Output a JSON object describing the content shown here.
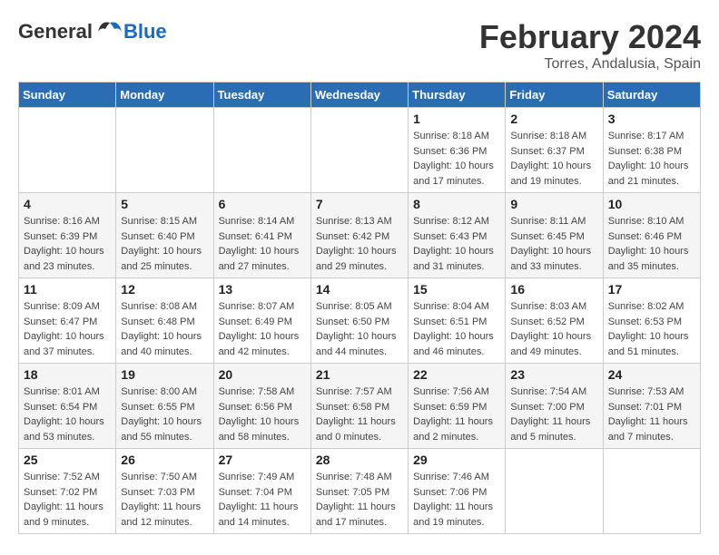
{
  "header": {
    "logo_general": "General",
    "logo_blue": "Blue",
    "month_year": "February 2024",
    "location": "Torres, Andalusia, Spain"
  },
  "days_of_week": [
    "Sunday",
    "Monday",
    "Tuesday",
    "Wednesday",
    "Thursday",
    "Friday",
    "Saturday"
  ],
  "weeks": [
    [
      {
        "day": "",
        "info": ""
      },
      {
        "day": "",
        "info": ""
      },
      {
        "day": "",
        "info": ""
      },
      {
        "day": "",
        "info": ""
      },
      {
        "day": "1",
        "info": "Sunrise: 8:18 AM\nSunset: 6:36 PM\nDaylight: 10 hours\nand 17 minutes."
      },
      {
        "day": "2",
        "info": "Sunrise: 8:18 AM\nSunset: 6:37 PM\nDaylight: 10 hours\nand 19 minutes."
      },
      {
        "day": "3",
        "info": "Sunrise: 8:17 AM\nSunset: 6:38 PM\nDaylight: 10 hours\nand 21 minutes."
      }
    ],
    [
      {
        "day": "4",
        "info": "Sunrise: 8:16 AM\nSunset: 6:39 PM\nDaylight: 10 hours\nand 23 minutes."
      },
      {
        "day": "5",
        "info": "Sunrise: 8:15 AM\nSunset: 6:40 PM\nDaylight: 10 hours\nand 25 minutes."
      },
      {
        "day": "6",
        "info": "Sunrise: 8:14 AM\nSunset: 6:41 PM\nDaylight: 10 hours\nand 27 minutes."
      },
      {
        "day": "7",
        "info": "Sunrise: 8:13 AM\nSunset: 6:42 PM\nDaylight: 10 hours\nand 29 minutes."
      },
      {
        "day": "8",
        "info": "Sunrise: 8:12 AM\nSunset: 6:43 PM\nDaylight: 10 hours\nand 31 minutes."
      },
      {
        "day": "9",
        "info": "Sunrise: 8:11 AM\nSunset: 6:45 PM\nDaylight: 10 hours\nand 33 minutes."
      },
      {
        "day": "10",
        "info": "Sunrise: 8:10 AM\nSunset: 6:46 PM\nDaylight: 10 hours\nand 35 minutes."
      }
    ],
    [
      {
        "day": "11",
        "info": "Sunrise: 8:09 AM\nSunset: 6:47 PM\nDaylight: 10 hours\nand 37 minutes."
      },
      {
        "day": "12",
        "info": "Sunrise: 8:08 AM\nSunset: 6:48 PM\nDaylight: 10 hours\nand 40 minutes."
      },
      {
        "day": "13",
        "info": "Sunrise: 8:07 AM\nSunset: 6:49 PM\nDaylight: 10 hours\nand 42 minutes."
      },
      {
        "day": "14",
        "info": "Sunrise: 8:05 AM\nSunset: 6:50 PM\nDaylight: 10 hours\nand 44 minutes."
      },
      {
        "day": "15",
        "info": "Sunrise: 8:04 AM\nSunset: 6:51 PM\nDaylight: 10 hours\nand 46 minutes."
      },
      {
        "day": "16",
        "info": "Sunrise: 8:03 AM\nSunset: 6:52 PM\nDaylight: 10 hours\nand 49 minutes."
      },
      {
        "day": "17",
        "info": "Sunrise: 8:02 AM\nSunset: 6:53 PM\nDaylight: 10 hours\nand 51 minutes."
      }
    ],
    [
      {
        "day": "18",
        "info": "Sunrise: 8:01 AM\nSunset: 6:54 PM\nDaylight: 10 hours\nand 53 minutes."
      },
      {
        "day": "19",
        "info": "Sunrise: 8:00 AM\nSunset: 6:55 PM\nDaylight: 10 hours\nand 55 minutes."
      },
      {
        "day": "20",
        "info": "Sunrise: 7:58 AM\nSunset: 6:56 PM\nDaylight: 10 hours\nand 58 minutes."
      },
      {
        "day": "21",
        "info": "Sunrise: 7:57 AM\nSunset: 6:58 PM\nDaylight: 11 hours\nand 0 minutes."
      },
      {
        "day": "22",
        "info": "Sunrise: 7:56 AM\nSunset: 6:59 PM\nDaylight: 11 hours\nand 2 minutes."
      },
      {
        "day": "23",
        "info": "Sunrise: 7:54 AM\nSunset: 7:00 PM\nDaylight: 11 hours\nand 5 minutes."
      },
      {
        "day": "24",
        "info": "Sunrise: 7:53 AM\nSunset: 7:01 PM\nDaylight: 11 hours\nand 7 minutes."
      }
    ],
    [
      {
        "day": "25",
        "info": "Sunrise: 7:52 AM\nSunset: 7:02 PM\nDaylight: 11 hours\nand 9 minutes."
      },
      {
        "day": "26",
        "info": "Sunrise: 7:50 AM\nSunset: 7:03 PM\nDaylight: 11 hours\nand 12 minutes."
      },
      {
        "day": "27",
        "info": "Sunrise: 7:49 AM\nSunset: 7:04 PM\nDaylight: 11 hours\nand 14 minutes."
      },
      {
        "day": "28",
        "info": "Sunrise: 7:48 AM\nSunset: 7:05 PM\nDaylight: 11 hours\nand 17 minutes."
      },
      {
        "day": "29",
        "info": "Sunrise: 7:46 AM\nSunset: 7:06 PM\nDaylight: 11 hours\nand 19 minutes."
      },
      {
        "day": "",
        "info": ""
      },
      {
        "day": "",
        "info": ""
      }
    ]
  ]
}
